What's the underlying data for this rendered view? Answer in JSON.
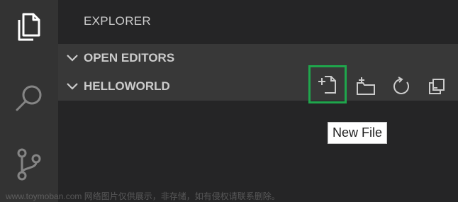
{
  "explorer": {
    "title": "EXPLORER",
    "sections": [
      {
        "label": "OPEN EDITORS"
      },
      {
        "label": "HELLOWORLD"
      }
    ]
  },
  "activity_bar": {
    "icons": [
      "files-icon",
      "search-icon",
      "source-control-icon"
    ]
  },
  "tooltip": {
    "text": "New File"
  },
  "highlight_color": "#1fa64c",
  "watermark": {
    "text": "www.toymoban.com 网络图片仅供展示，非存储，如有侵权请联系删除。"
  }
}
